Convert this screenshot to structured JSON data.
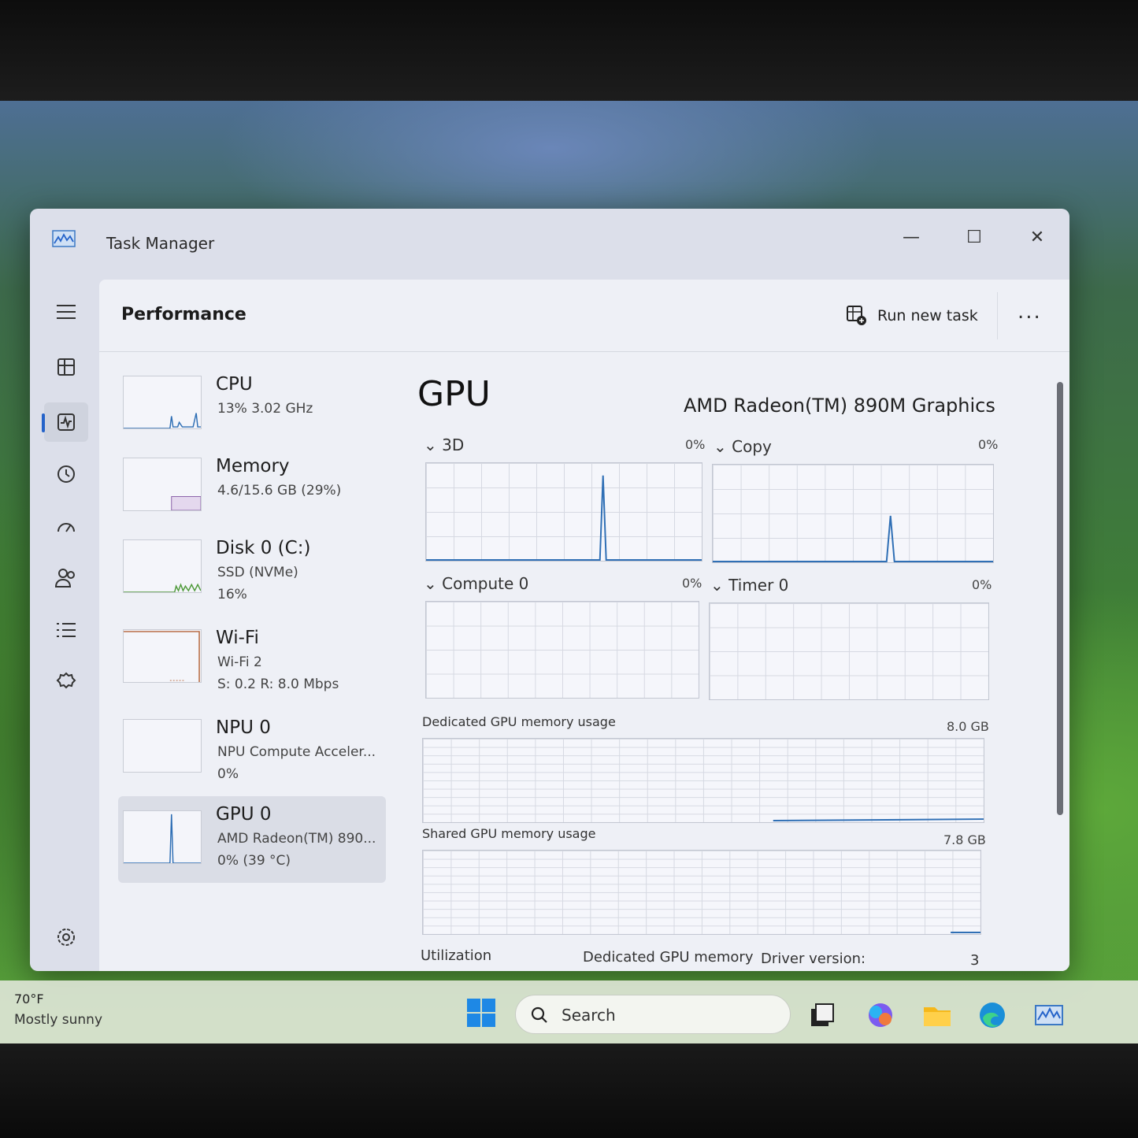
{
  "window": {
    "title": "Task Manager",
    "minimize_glyph": "—",
    "maximize_glyph": "☐",
    "close_glyph": "✕"
  },
  "header": {
    "page_title": "Performance",
    "run_new_task": "Run new task",
    "more": "..."
  },
  "devices": [
    {
      "name": "CPU",
      "sub1": "13%  3.02 GHz",
      "sub2": "",
      "graph_color": "#2f6fb5"
    },
    {
      "name": "Memory",
      "sub1": "4.6/15.6 GB (29%)",
      "sub2": "",
      "graph_color": "#8a5fa8"
    },
    {
      "name": "Disk 0 (C:)",
      "sub1": "SSD (NVMe)",
      "sub2": "16%",
      "graph_color": "#4f9a3a"
    },
    {
      "name": "Wi-Fi",
      "sub1": "Wi-Fi 2",
      "sub2": "S: 0.2  R: 8.0 Mbps",
      "graph_color": "#b5653a"
    },
    {
      "name": "NPU 0",
      "sub1": "NPU Compute Acceler...",
      "sub2": "0%",
      "graph_color": "#2f6fb5"
    },
    {
      "name": "GPU 0",
      "sub1": "AMD Radeon(TM) 890...",
      "sub2": "0%  (39 °C)",
      "graph_color": "#2f6fb5"
    }
  ],
  "gpu": {
    "title": "GPU",
    "model": "AMD Radeon(TM) 890M Graphics",
    "engines": [
      {
        "label": "3D",
        "pct": "0%"
      },
      {
        "label": "Copy",
        "pct": "0%"
      },
      {
        "label": "Compute 0",
        "pct": "0%"
      },
      {
        "label": "Timer 0",
        "pct": "0%"
      }
    ],
    "dedicated_label": "Dedicated GPU memory usage",
    "dedicated_max": "8.0 GB",
    "shared_label": "Shared GPU memory usage",
    "shared_max": "7.8 GB",
    "stats": {
      "utilization": "Utilization",
      "dedicated_memory": "Dedicated GPU memory",
      "driver_version": "Driver version:",
      "driver_value": "3"
    }
  },
  "taskbar": {
    "weather_temp": "70°F",
    "weather_desc": "Mostly sunny",
    "search_placeholder": "Search"
  },
  "colors": {
    "accent": "#2563c9",
    "graph_line": "#2f6fb5"
  }
}
